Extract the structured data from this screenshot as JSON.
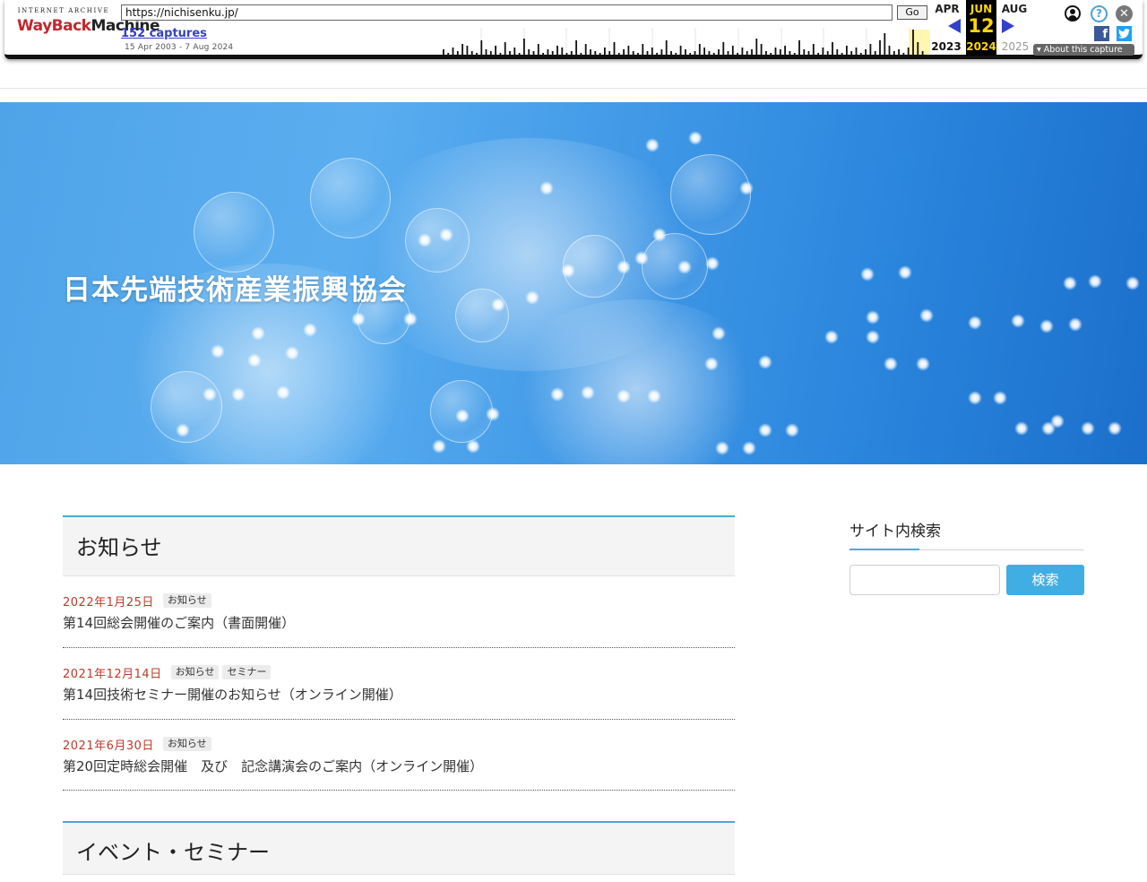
{
  "wayback": {
    "logo_top": "INTERNET ARCHIVE",
    "logo_wayback": "WayBack",
    "logo_machine": "Machine",
    "url": "https://nichisenku.jp/",
    "go_label": "Go",
    "captures_label": "152 captures",
    "date_range": "15 Apr 2003 - 7 Aug 2024",
    "prev_month": "APR",
    "current_month": "JUN",
    "next_month": "AUG",
    "current_day": "12",
    "prev_year": "2023",
    "current_year": "2024",
    "next_year": "2025",
    "about_label": "About this capture",
    "help_glyph": "?",
    "close_glyph": "✕",
    "facebook_glyph": "f",
    "twitter_glyph": "🐦",
    "sparkline_bars": [
      3,
      1,
      4,
      2,
      6,
      5,
      2,
      1,
      8,
      3,
      2,
      5,
      1,
      7,
      2,
      4,
      1,
      9,
      3,
      2,
      6,
      1,
      3,
      2,
      5,
      4,
      1,
      2,
      8,
      1,
      6,
      3,
      2,
      1,
      4,
      2,
      7,
      1,
      3,
      5,
      2,
      1,
      6,
      2,
      4,
      1,
      3,
      8,
      2,
      1,
      5,
      3,
      1,
      2,
      6,
      4,
      2,
      1,
      3,
      7,
      2,
      5,
      1,
      4,
      2,
      3,
      9,
      6,
      2,
      1,
      4,
      3,
      5,
      2,
      1,
      8,
      3,
      2,
      6,
      1,
      4,
      2,
      7,
      3,
      1,
      5,
      2,
      4,
      1,
      3,
      6,
      2,
      8,
      12,
      5,
      2,
      3,
      1,
      4,
      14,
      7,
      2
    ],
    "colors": {
      "arrow": "#3340c8",
      "highlight": "#ffd700",
      "captures_link": "#3340c8"
    }
  },
  "site": {
    "hero_title": "日本先端技術産業振興協会",
    "news": {
      "heading": "お知らせ",
      "items": [
        {
          "date": "2022年1月25日",
          "tags": [
            "お知らせ"
          ],
          "title": "第14回総会開催のご案内（書面開催）"
        },
        {
          "date": "2021年12月14日",
          "tags": [
            "お知らせ",
            "セミナー"
          ],
          "title": "第14回技術セミナー開催のお知らせ（オンライン開催）"
        },
        {
          "date": "2021年6月30日",
          "tags": [
            "お知らせ"
          ],
          "title": "第20回定時総会開催　及び　記念講演会のご案内（オンライン開催）"
        }
      ]
    },
    "events": {
      "heading": "イベント・セミナー"
    },
    "sidebar": {
      "search_heading": "サイト内検索",
      "search_placeholder": "",
      "search_button": "検索"
    },
    "colors": {
      "accent": "#4aa8d8",
      "date_red": "#c0392b",
      "button": "#41aee3"
    }
  }
}
